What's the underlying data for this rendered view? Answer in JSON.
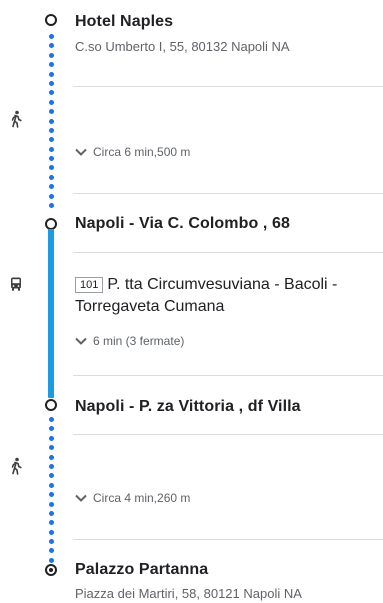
{
  "origin": {
    "name": "Hotel Naples",
    "address": "C.so Umberto I, 55, 80132 Napoli NA"
  },
  "walk1": {
    "mode_icon": "walking-icon",
    "summary": "Circa 6 min,500 m"
  },
  "stop1": {
    "name": "Napoli - Via C. Colombo , 68"
  },
  "transit": {
    "mode_icon": "bus-icon",
    "line_number": "101",
    "line_route": "P. tta Circumvesuviana - Bacoli - Torregaveta Cumana",
    "summary": "6 min (3 fermate)",
    "color": "#1e9be5"
  },
  "stop2": {
    "name": "Napoli - P. za Vittoria , df Villa"
  },
  "walk2": {
    "mode_icon": "walking-icon",
    "summary": "Circa 4 min,260 m"
  },
  "destination": {
    "name": "Palazzo Partanna",
    "address": "Piazza dei Martiri, 58, 80121 Napoli NA"
  },
  "colors": {
    "walk_dots": "#1a73e8",
    "text": "#202124",
    "secondary": "#5f6368"
  }
}
